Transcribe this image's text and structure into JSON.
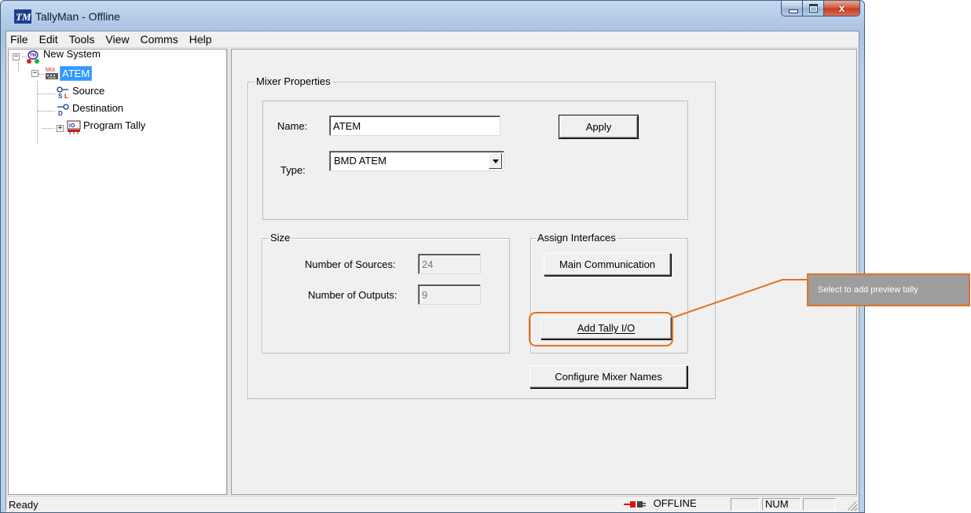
{
  "window": {
    "title": "TallyMan - Offline",
    "app_icon": "tallyman-logo-icon"
  },
  "menu": [
    "File",
    "Edit",
    "Tools",
    "View",
    "Comms",
    "Help"
  ],
  "tree": {
    "root": "New System",
    "mixer": "ATEM",
    "children": [
      "Source",
      "Destination",
      "Program Tally"
    ]
  },
  "mixer_properties": {
    "group_title": "Mixer Properties",
    "name_label": "Name:",
    "name_value": "ATEM",
    "type_label": "Type:",
    "type_value": "BMD ATEM",
    "apply_label": "Apply"
  },
  "size": {
    "group_title": "Size",
    "sources_label": "Number of Sources:",
    "sources_value": "24",
    "outputs_label": "Number of Outputs:",
    "outputs_value": "9"
  },
  "assign": {
    "group_title": "Assign Interfaces",
    "main_comm_label": "Main Communication",
    "add_tally_label": "Add Tally I/O"
  },
  "configure_names_label": "Configure Mixer Names",
  "status": {
    "ready": "Ready",
    "offline": "OFFLINE",
    "num": "NUM"
  },
  "callout": {
    "text": "Select to add preview tally",
    "color": "#e37222"
  }
}
